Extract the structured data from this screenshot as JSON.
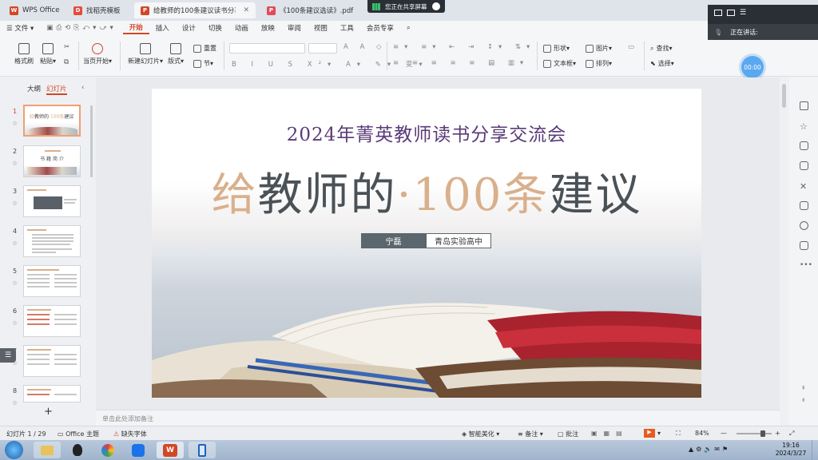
{
  "tabs": [
    {
      "label": "WPS Office",
      "icon": "wps-icon",
      "color": "#d24726"
    },
    {
      "label": "找稻壳模板",
      "icon": "docer-icon",
      "color": "#e84a3a"
    },
    {
      "label": "给教师的100条建议读书分享",
      "icon": "ppt-icon",
      "color": "#d24726"
    },
    {
      "label": "《100条建议选读》.pdf",
      "icon": "pdf-icon",
      "color": "#e14b5a"
    }
  ],
  "share_banner": "您正在共享屏幕",
  "menu": {
    "file": "文件",
    "items": [
      "开始",
      "插入",
      "设计",
      "切换",
      "动画",
      "放映",
      "审阅",
      "视图",
      "工具",
      "会员专享"
    ],
    "active": "开始"
  },
  "ribbon": {
    "format_painter": "格式刷",
    "paste": "粘贴",
    "play_from_current": "当页开始",
    "new_slide": "新建幻灯片",
    "layout": "版式",
    "section": "节",
    "reset": "重置",
    "shape": "形状",
    "picture": "图片",
    "textbox": "文本框",
    "arrange": "排列",
    "find": "查找",
    "select": "选择"
  },
  "left_panel": {
    "tab_outline": "大纲",
    "tab_slides": "幻灯片",
    "slide_numbers": [
      "1",
      "2",
      "3",
      "4",
      "5",
      "6",
      "7",
      "8"
    ],
    "slide2_title": "书 籍 简 介",
    "add_label": "+"
  },
  "slide": {
    "subtitle": "2024年菁英教师读书分享交流会",
    "title_1": "给",
    "title_2": "教师的",
    "title_3": "·100条",
    "title_4": "建议",
    "presenter": "宁磊",
    "school": "青岛实验高中"
  },
  "notes_placeholder": "单击此处添加备注",
  "status": {
    "slide_info": "幻灯片 1 / 29",
    "theme": "Office 主题",
    "missing_font": "缺失字体",
    "smart_beautify": "智能美化",
    "notes": "备注",
    "comments": "批注",
    "zoom": "84%"
  },
  "talk_panel": {
    "label": "正在讲话:"
  },
  "timer": "00:00",
  "clock": {
    "time": "19:16",
    "date": "2024/3/27"
  },
  "colors": {
    "accent": "#d24726",
    "title_tan": "#d9b08c",
    "title_dark": "#4a5257",
    "subtitle_purple": "#5a3a78"
  }
}
